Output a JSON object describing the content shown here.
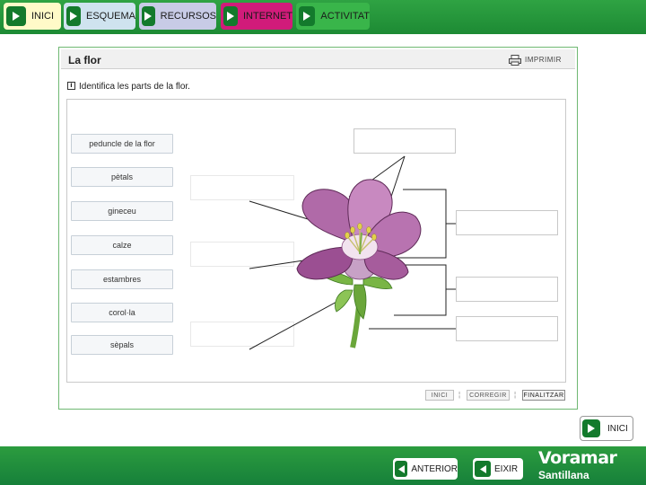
{
  "nav": {
    "tabs": [
      {
        "label": "INICI",
        "color": "#fffac8"
      },
      {
        "label": "ESQUEMA",
        "color": "#cfe3ef"
      },
      {
        "label": "RECURSOS",
        "color": "#c8cbe6"
      },
      {
        "label": "INTERNET",
        "color": "#d11b7a"
      },
      {
        "label": "ACTIVITAT",
        "color": "#39b54a"
      }
    ]
  },
  "panel": {
    "title": "La flor",
    "print_label": "IMPRIMIR",
    "instruction": "Identifica les parts de la flor."
  },
  "labels": [
    "peduncle de la flor",
    "pètals",
    "gineceu",
    "calze",
    "estambres",
    "corol·la",
    "sèpals"
  ],
  "controls": {
    "inici": "INICI",
    "corregir": "CORREGIR",
    "finalitzar": "FINALITZAR"
  },
  "bottom": {
    "inici": "INICI",
    "anterior": "ANTERIOR",
    "eixir": "EIXIR",
    "brand_line1": "Voramar",
    "brand_line2": "Santillana"
  },
  "colors": {
    "accent_green": "#2fa343",
    "dark_green": "#137a2c"
  }
}
